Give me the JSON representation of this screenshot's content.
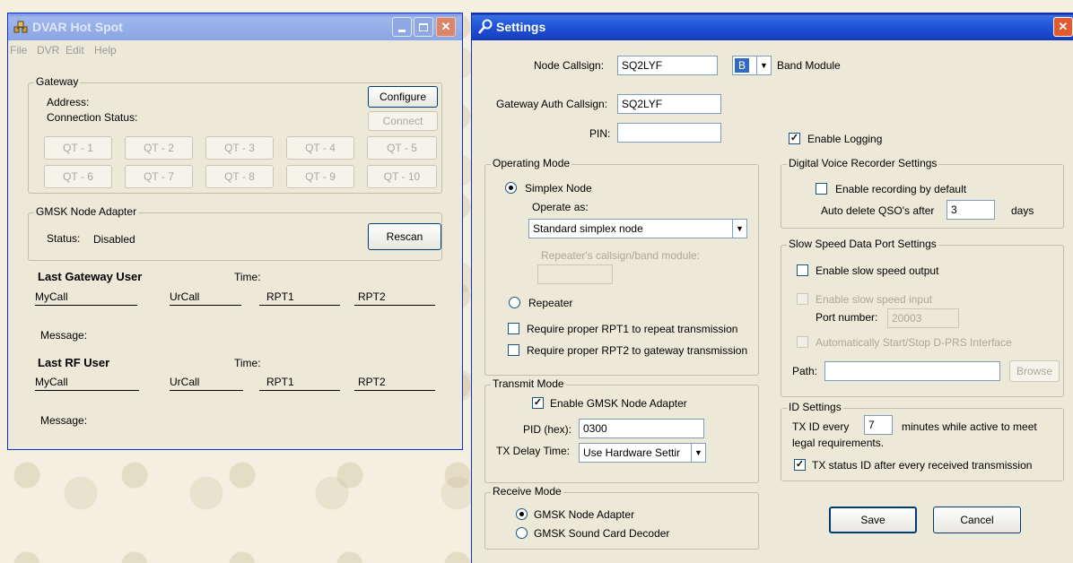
{
  "hotspot": {
    "title": "DVAR Hot Spot",
    "menu": [
      "File",
      "DVR",
      "Edit",
      "Help"
    ],
    "gateway": {
      "legend": "Gateway",
      "address_label": "Address:",
      "connection_label": "Connection Status:",
      "configure_label": "Configure",
      "connect_label": "Connect",
      "qt_buttons": [
        "QT - 1",
        "QT - 2",
        "QT - 3",
        "QT - 4",
        "QT - 5",
        "QT - 6",
        "QT - 7",
        "QT - 8",
        "QT - 9",
        "QT - 10"
      ]
    },
    "gmsk": {
      "legend": "GMSK Node Adapter",
      "status_label": "Status:",
      "status_value": "Disabled",
      "rescan_label": "Rescan"
    },
    "last_gateway": {
      "heading": "Last Gateway User",
      "time_label": "Time:",
      "mycall": "MyCall",
      "urcall": "UrCall",
      "rpt1": "RPT1",
      "rpt2": "RPT2",
      "message_label": "Message:"
    },
    "last_rf": {
      "heading": "Last RF User",
      "time_label": "Time:",
      "mycall": "MyCall",
      "urcall": "UrCall",
      "rpt1": "RPT1",
      "rpt2": "RPT2",
      "message_label": "Message:"
    }
  },
  "settings": {
    "title": "Settings",
    "node_callsign_label": "Node Callsign:",
    "node_callsign_value": "SQ2LYF",
    "band_value": "B",
    "band_module_label": "Band Module",
    "gateway_auth_label": "Gateway Auth Callsign:",
    "gateway_auth_value": "SQ2LYF",
    "pin_label": "PIN:",
    "pin_value": "",
    "enable_logging_label": "Enable Logging",
    "enable_logging_checked": true,
    "operating_mode": {
      "legend": "Operating Mode",
      "simplex_label": "Simplex Node",
      "operate_as_label": "Operate as:",
      "operate_as_value": "Standard simplex node",
      "repeater_callsign_label": "Repeater's callsign/band module:",
      "repeater_label": "Repeater",
      "req_rpt1_label": "Require proper RPT1 to repeat transmission",
      "req_rpt2_label": "Require proper RPT2 to gateway transmission"
    },
    "transmit_mode": {
      "legend": "Transmit Mode",
      "enable_gmsk_label": "Enable GMSK Node Adapter",
      "pid_label": "PID (hex):",
      "pid_value": "0300",
      "tx_delay_label": "TX Delay Time:",
      "tx_delay_value": "Use Hardware Settir"
    },
    "receive_mode": {
      "legend": "Receive Mode",
      "gmsk_adapter_label": "GMSK Node Adapter",
      "sound_card_label": "GMSK Sound Card Decoder"
    },
    "dvr": {
      "legend": "Digital Voice Recorder Settings",
      "enable_recording_label": "Enable recording by default",
      "auto_delete_label": "Auto delete QSO's after",
      "auto_delete_value": "3",
      "days_label": "days"
    },
    "slow_data": {
      "legend": "Slow Speed Data Port Settings",
      "enable_output_label": "Enable slow speed output",
      "enable_input_label": "Enable slow speed input",
      "port_number_label": "Port number:",
      "port_number_value": "20003",
      "auto_dprs_label": "Automatically Start/Stop D-PRS Interface",
      "path_label": "Path:",
      "path_value": "",
      "browse_label": "Browse"
    },
    "id_settings": {
      "legend": "ID Settings",
      "tx_id_every_label": "TX ID every",
      "tx_id_value": "7",
      "minutes_label": "minutes while active to meet",
      "legal_label": "legal requirements.",
      "tx_status_label": "TX status ID after every received transmission"
    },
    "save_label": "Save",
    "cancel_label": "Cancel"
  }
}
